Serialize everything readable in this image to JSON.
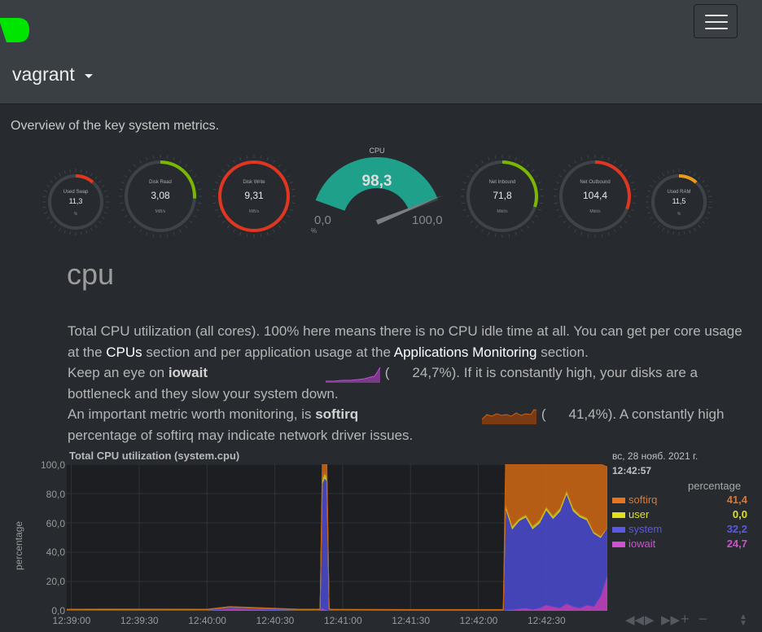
{
  "navbar": {
    "host": "vagrant",
    "logo_color": "#00ff00"
  },
  "header": {
    "subtitle": "Overview of the key system metrics."
  },
  "gauges": [
    {
      "label": "Used Swap",
      "value": "11,3",
      "unit": "%",
      "fraction": 0.113,
      "color": "#e0351e"
    },
    {
      "label": "Disk Read",
      "value": "3,08",
      "unit": "MiB/s",
      "fraction": 0.26,
      "color": "#7ab800"
    },
    {
      "label": "Disk Write",
      "value": "9,31",
      "unit": "MiB/s",
      "fraction": 1.0,
      "color": "#e0351e"
    },
    {
      "label": "Net Inbound",
      "value": "71,8",
      "unit": "Mbit/s",
      "fraction": 0.3,
      "color": "#7ab800"
    },
    {
      "label": "Net Outbound",
      "value": "104,4",
      "unit": "Mbit/s",
      "fraction": 0.31,
      "color": "#e0351e"
    },
    {
      "label": "Used RAM",
      "value": "11,5",
      "unit": "%",
      "fraction": 0.115,
      "color": "#e89a1c"
    }
  ],
  "cpu_gauge": {
    "title": "CPU",
    "value": "98,3",
    "min": "0,0",
    "max": "100,0",
    "unit": "%",
    "fraction": 0.983,
    "color": "#1fa08a"
  },
  "section": {
    "title": "cpu",
    "p1a": "Total CPU utilization (all cores). 100% here means there is no CPU idle time at all. You can get per core usage at the ",
    "cpus_link": "CPUs",
    "p1b": " section and per application usage at the ",
    "apps_link": "Applications Monitoring",
    "p1c": " section.",
    "p2a": "Keep an eye on ",
    "iowait": "iowait",
    "p2_val": "24,7%",
    "p2b": "). If it is constantly high, your disks are a bottleneck and they slow your system down.",
    "p3a": "An important metric worth monitoring, is ",
    "softirq": "softirq",
    "p3_val": "41,4%",
    "p3b": "). A constantly high percentage of softirq may indicate network driver issues.",
    "open_paren": "("
  },
  "chart_data": {
    "type": "area",
    "title": "Total CPU utilization (system.cpu)",
    "ylabel": "percentage",
    "ylim": [
      0,
      100
    ],
    "yticks": [
      "100,0",
      "80,0",
      "60,0",
      "40,0",
      "20,0",
      "0,0"
    ],
    "xticks": [
      "12:39:00",
      "12:39:30",
      "12:40:00",
      "12:40:30",
      "12:41:00",
      "12:41:30",
      "12:42:00",
      "12:42:30"
    ],
    "x": [
      "12:38:58",
      "12:39:30",
      "12:40:00",
      "12:40:10",
      "12:40:40",
      "12:40:49",
      "12:40:50",
      "12:40:51",
      "12:40:52",
      "12:40:53",
      "12:40:54",
      "12:40:55",
      "12:40:56",
      "12:40:57",
      "12:41:30",
      "12:42:00",
      "12:42:11",
      "12:42:12",
      "12:42:15",
      "12:42:18",
      "12:42:21",
      "12:42:24",
      "12:42:27",
      "12:42:30",
      "12:42:33",
      "12:42:36",
      "12:42:39",
      "12:42:42",
      "12:42:45",
      "12:42:48",
      "12:42:51",
      "12:42:54",
      "12:42:57"
    ],
    "series": [
      {
        "name": "iowait",
        "color": "#c040c0",
        "values": [
          0.3,
          0.4,
          0.3,
          1.5,
          0.4,
          0.3,
          0.5,
          2,
          1,
          0.5,
          0.3,
          0.3,
          0.3,
          0.3,
          0.2,
          0.2,
          0.2,
          0.5,
          1,
          1.5,
          2,
          1,
          2,
          4,
          3,
          2,
          5,
          3,
          2,
          4,
          3,
          10,
          24.7
        ]
      },
      {
        "name": "system",
        "color": "#4a48c8",
        "values": [
          0.5,
          0.5,
          0.5,
          1,
          0.5,
          0.5,
          0.5,
          85,
          90,
          88,
          1,
          0.5,
          0.5,
          0.5,
          0.5,
          0.5,
          0.5,
          70,
          55,
          60,
          62,
          55,
          58,
          65,
          60,
          66,
          75,
          65,
          62,
          58,
          50,
          40,
          32.2
        ]
      },
      {
        "name": "user",
        "color": "#c8c81e",
        "values": [
          0.1,
          0.1,
          0.1,
          0.1,
          0.1,
          0.1,
          0.1,
          3,
          3,
          3,
          0.1,
          0.1,
          0.1,
          0.1,
          0.1,
          0.1,
          0.1,
          2,
          2,
          1.5,
          1.5,
          2,
          2,
          2,
          2,
          2,
          2,
          2,
          1.5,
          1.5,
          1,
          1,
          0
        ]
      },
      {
        "name": "softirq",
        "color": "#c86414",
        "values": [
          0.2,
          0.2,
          0.2,
          0.3,
          0.2,
          0.2,
          0.2,
          12,
          6,
          8.5,
          0.1,
          0.1,
          0.1,
          0.1,
          0.1,
          0.1,
          0.1,
          27.5,
          42,
          37,
          34.5,
          42,
          38,
          29,
          35,
          30,
          18,
          30,
          34.5,
          36.5,
          46,
          49,
          41.4
        ]
      }
    ],
    "legend": {
      "date": "вс, 28 нояб. 2021 г.",
      "time": "12:42:57",
      "units": "percentage",
      "entries": [
        {
          "name": "softirq",
          "value": "41,4",
          "color": "#e8741e"
        },
        {
          "name": "user",
          "value": "0,0",
          "color": "#e0e01e"
        },
        {
          "name": "system",
          "value": "32,2",
          "color": "#5a58e8"
        },
        {
          "name": "iowait",
          "value": "24,7",
          "color": "#d050d0"
        }
      ]
    },
    "grid": true,
    "background": "#1c1e22"
  },
  "toolbar": {
    "icons": [
      "rewind-icon",
      "play-icon",
      "fast-forward-icon",
      "zoom-in-icon",
      "zoom-out-icon",
      "resize-icon"
    ]
  }
}
